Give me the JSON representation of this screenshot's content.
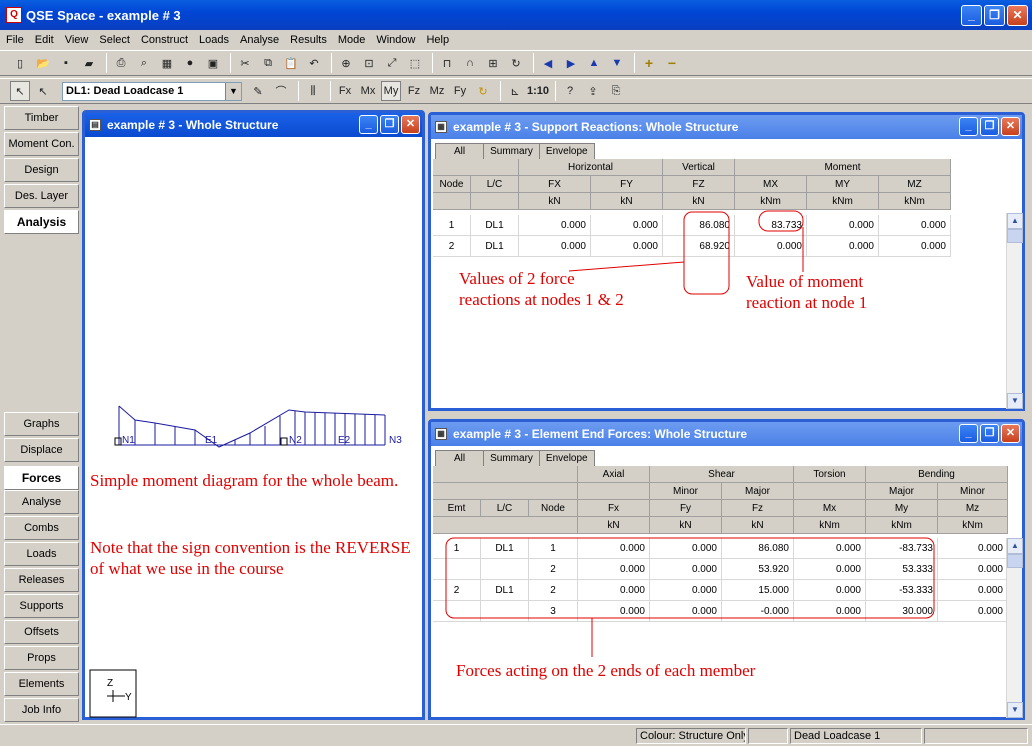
{
  "app": {
    "title": "QSE Space - example # 3"
  },
  "menu": [
    "File",
    "Edit",
    "View",
    "Select",
    "Construct",
    "Loads",
    "Analyse",
    "Results",
    "Mode",
    "Window",
    "Help"
  ],
  "loadcase": {
    "selected": "DL1: Dead Loadcase 1"
  },
  "sidebar": {
    "top": [
      "Timber",
      "Moment Con.",
      "Design",
      "Des. Layer",
      "Analysis"
    ],
    "bottom": [
      "Graphs",
      "Displace",
      "Forces",
      "Analyse",
      "Combs",
      "Loads",
      "Releases",
      "Supports",
      "Offsets",
      "Props",
      "Elements",
      "Job Info"
    ],
    "active_top": "Analysis",
    "active_bottom": "Forces"
  },
  "structure_window": {
    "title": "example # 3 - Whole Structure",
    "labels": {
      "n1": "N1",
      "e1": "E1",
      "n2": "N2",
      "e2": "E2",
      "n3": "N3"
    },
    "axes": {
      "z": "Z",
      "y": "Y"
    }
  },
  "reactions_window": {
    "title": "example # 3 - Support Reactions: Whole Structure",
    "tabs": [
      "All",
      "Summary",
      "Envelope"
    ],
    "groups": [
      "Horizontal",
      "Vertical",
      "Moment"
    ],
    "columns": [
      {
        "name": "Node",
        "unit": ""
      },
      {
        "name": "L/C",
        "unit": ""
      },
      {
        "name": "FX",
        "unit": "kN"
      },
      {
        "name": "FY",
        "unit": "kN"
      },
      {
        "name": "FZ",
        "unit": "kN"
      },
      {
        "name": "MX",
        "unit": "kNm"
      },
      {
        "name": "MY",
        "unit": "kNm"
      },
      {
        "name": "MZ",
        "unit": "kNm"
      }
    ],
    "rows": [
      [
        "1",
        "DL1",
        "0.000",
        "0.000",
        "86.080",
        "83.733",
        "0.000",
        "0.000"
      ],
      [
        "2",
        "DL1",
        "0.000",
        "0.000",
        "68.920",
        "0.000",
        "0.000",
        "0.000"
      ]
    ]
  },
  "forces_window": {
    "title": "example # 3 - Element End Forces: Whole Structure",
    "tabs": [
      "All",
      "Summary",
      "Envelope"
    ],
    "groups": [
      "Axial",
      "Shear",
      "Torsion",
      "Bending"
    ],
    "subgroups": [
      "Minor",
      "Major",
      "Major",
      "Minor"
    ],
    "columns": [
      {
        "name": "Emt",
        "unit": ""
      },
      {
        "name": "L/C",
        "unit": ""
      },
      {
        "name": "Node",
        "unit": ""
      },
      {
        "name": "Fx",
        "unit": "kN"
      },
      {
        "name": "Fy",
        "unit": "kN"
      },
      {
        "name": "Fz",
        "unit": "kN"
      },
      {
        "name": "Mx",
        "unit": "kNm"
      },
      {
        "name": "My",
        "unit": "kNm"
      },
      {
        "name": "Mz",
        "unit": "kNm"
      }
    ],
    "rows": [
      [
        "1",
        "DL1",
        "1",
        "0.000",
        "0.000",
        "86.080",
        "0.000",
        "-83.733",
        "0.000"
      ],
      [
        "",
        "",
        "2",
        "0.000",
        "0.000",
        "53.920",
        "0.000",
        "53.333",
        "0.000"
      ],
      [
        "2",
        "DL1",
        "2",
        "0.000",
        "0.000",
        "15.000",
        "0.000",
        "-53.333",
        "0.000"
      ],
      [
        "",
        "",
        "3",
        "0.000",
        "0.000",
        "-0.000",
        "0.000",
        "30.000",
        "0.000"
      ]
    ]
  },
  "annotations": {
    "moment_note_1": "Simple moment diagram for the whole beam.",
    "moment_note_2": "Note that the sign convention is the REVERSE of what we use in the course",
    "force_reactions": "Values of 2 force reactions at nodes 1 & 2",
    "moment_reaction": "Value of moment reaction at node 1",
    "end_forces": "Forces acting on the 2 ends of each member",
    "color": "#e00000"
  },
  "status": {
    "colour": "Colour: Structure Only",
    "loadcase": "Dead Loadcase 1"
  },
  "colors": {
    "titlebar": "#0a4ad0",
    "annotation": "#e00000",
    "diagram": "#1a1aa0"
  }
}
